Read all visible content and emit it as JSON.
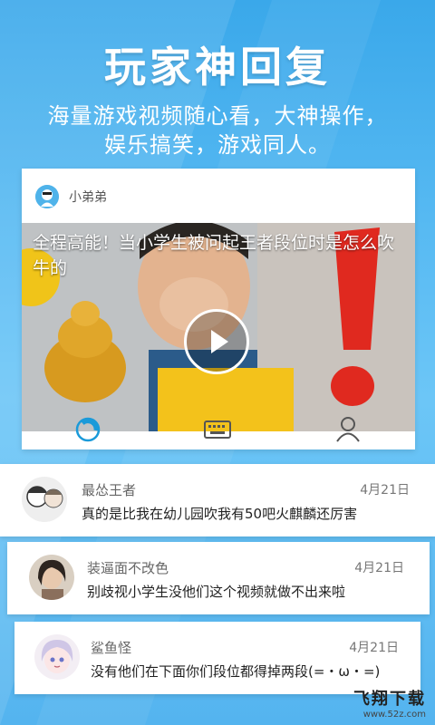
{
  "promo": {
    "headline": "玩家神回复",
    "tagline_line1": "海量游戏视频随心看，大神操作，",
    "tagline_line2": "娱乐搞笑，游戏同人。"
  },
  "post": {
    "author": "小弟弟",
    "video_title": "全程高能！当小学生被问起王者段位时是怎么吹牛的"
  },
  "toolbar": {
    "icons": [
      "refresh-icon",
      "keyboard-icon",
      "user-icon"
    ]
  },
  "comments": [
    {
      "name": "最怂王者",
      "date": "4月21日",
      "text": "真的是比我在幼儿园吹我有50吧火麒麟还厉害"
    },
    {
      "name": "装逼面不改色",
      "date": "4月21日",
      "text": "别歧视小学生没他们这个视频就做不出来啦"
    },
    {
      "name": "鲨鱼怪",
      "date": "4月21日",
      "text": "没有他们在下面你们段位都得掉两段(=・ω・=)"
    }
  ],
  "watermark": {
    "main": "飞翔下载",
    "url": "www.52z.com"
  },
  "colors": {
    "background": "#4fb3ee",
    "accent": "#1a9ad9"
  }
}
